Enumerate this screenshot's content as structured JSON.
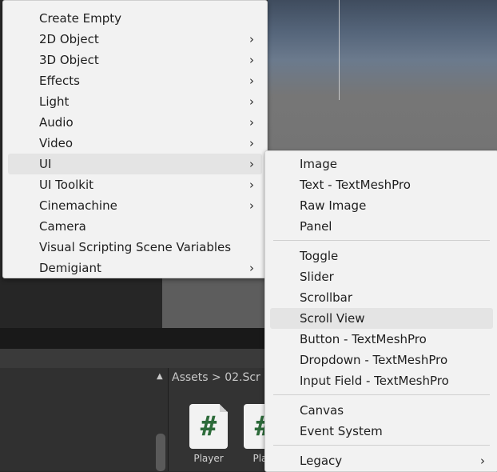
{
  "main_menu": {
    "items": [
      {
        "label": "Create Empty",
        "submenu": false
      },
      {
        "label": "2D Object",
        "submenu": true
      },
      {
        "label": "3D Object",
        "submenu": true
      },
      {
        "label": "Effects",
        "submenu": true
      },
      {
        "label": "Light",
        "submenu": true
      },
      {
        "label": "Audio",
        "submenu": true
      },
      {
        "label": "Video",
        "submenu": true
      },
      {
        "label": "UI",
        "submenu": true,
        "highlighted": true
      },
      {
        "label": "UI Toolkit",
        "submenu": true
      },
      {
        "label": "Cinemachine",
        "submenu": true
      },
      {
        "label": "Camera",
        "submenu": false
      },
      {
        "label": "Visual Scripting Scene Variables",
        "submenu": false
      },
      {
        "label": "Demigiant",
        "submenu": true
      }
    ]
  },
  "ui_submenu": {
    "items": [
      {
        "label": "Image"
      },
      {
        "label": "Text - TextMeshPro"
      },
      {
        "label": "Raw Image"
      },
      {
        "label": "Panel"
      },
      {
        "label": "Toggle"
      },
      {
        "label": "Slider"
      },
      {
        "label": "Scrollbar"
      },
      {
        "label": "Scroll View",
        "highlighted": true
      },
      {
        "label": "Button - TextMeshPro"
      },
      {
        "label": "Dropdown - TextMeshPro"
      },
      {
        "label": "Input Field - TextMeshPro"
      },
      {
        "label": "Canvas"
      },
      {
        "label": "Event System"
      },
      {
        "label": "Legacy",
        "submenu": true
      }
    ]
  },
  "project": {
    "breadcrumb": "Assets > 02.Scr",
    "assets": [
      {
        "name": "Player",
        "icon": "csharp-script-icon",
        "glyph": "#"
      },
      {
        "name": "Play",
        "icon": "csharp-script-icon",
        "glyph": "#"
      }
    ]
  },
  "glyphs": {
    "arrow": "›",
    "scroll_up": "▲"
  },
  "colors": {
    "menu_bg": "#f2f2f2",
    "highlight": "#e4e4e4",
    "script_hash": "#2d6b3a"
  }
}
